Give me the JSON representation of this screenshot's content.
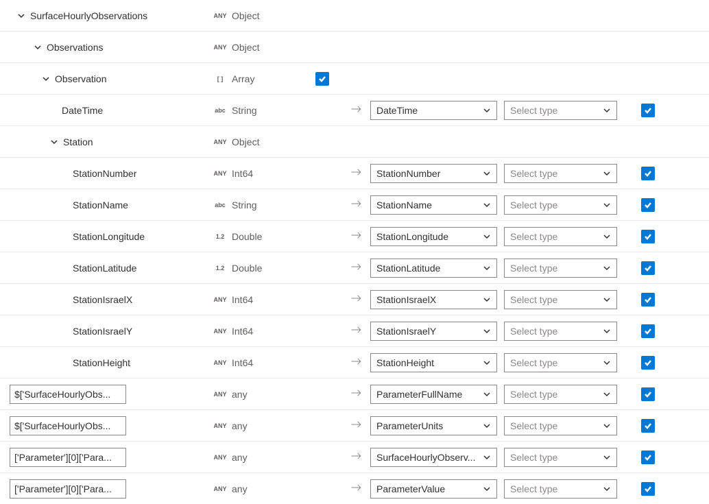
{
  "selectTypePlaceholder": "Select type",
  "rows": [
    {
      "indent": 24,
      "chev": true,
      "name": "SurfaceHourlyObservations",
      "box": false,
      "tIcon": "ANY",
      "tLabel": "Object",
      "leaf": false,
      "rootCheck": false
    },
    {
      "indent": 48,
      "chev": true,
      "name": "Observations",
      "box": false,
      "tIcon": "ANY",
      "tLabel": "Object",
      "leaf": false,
      "rootCheck": false
    },
    {
      "indent": 60,
      "chev": true,
      "name": "Observation",
      "box": false,
      "tIcon": "[ ]",
      "tLabel": "Array",
      "leaf": false,
      "rootCheck": true
    },
    {
      "indent": 90,
      "chev": false,
      "name": "DateTime",
      "box": false,
      "tIcon": "abc",
      "tLabel": "String",
      "leaf": true,
      "map": "DateTime"
    },
    {
      "indent": 72,
      "chev": true,
      "name": "Station",
      "box": false,
      "tIcon": "ANY",
      "tLabel": "Object",
      "leaf": false,
      "rootCheck": false
    },
    {
      "indent": 106,
      "chev": false,
      "name": "StationNumber",
      "box": false,
      "tIcon": "ANY",
      "tLabel": "Int64",
      "leaf": true,
      "map": "StationNumber"
    },
    {
      "indent": 106,
      "chev": false,
      "name": "StationName",
      "box": false,
      "tIcon": "abc",
      "tLabel": "String",
      "leaf": true,
      "map": "StationName"
    },
    {
      "indent": 106,
      "chev": false,
      "name": "StationLongitude",
      "box": false,
      "tIcon": "1.2",
      "tLabel": "Double",
      "leaf": true,
      "map": "StationLongitude"
    },
    {
      "indent": 106,
      "chev": false,
      "name": "StationLatitude",
      "box": false,
      "tIcon": "1.2",
      "tLabel": "Double",
      "leaf": true,
      "map": "StationLatitude"
    },
    {
      "indent": 106,
      "chev": false,
      "name": "StationIsraelX",
      "box": false,
      "tIcon": "ANY",
      "tLabel": "Int64",
      "leaf": true,
      "map": "StationIsraelX"
    },
    {
      "indent": 106,
      "chev": false,
      "name": "StationIsraelY",
      "box": false,
      "tIcon": "ANY",
      "tLabel": "Int64",
      "leaf": true,
      "map": "StationIsraelY"
    },
    {
      "indent": 106,
      "chev": false,
      "name": "StationHeight",
      "box": false,
      "tIcon": "ANY",
      "tLabel": "Int64",
      "leaf": true,
      "map": "StationHeight"
    },
    {
      "indent": 0,
      "chev": false,
      "name": "$['SurfaceHourlyObs...",
      "box": true,
      "tIcon": "ANY",
      "tLabel": "any",
      "leaf": true,
      "map": "ParameterFullName"
    },
    {
      "indent": 0,
      "chev": false,
      "name": "$['SurfaceHourlyObs...",
      "box": true,
      "tIcon": "ANY",
      "tLabel": "any",
      "leaf": true,
      "map": "ParameterUnits"
    },
    {
      "indent": 0,
      "chev": false,
      "name": "['Parameter'][0]['Para...",
      "box": true,
      "tIcon": "ANY",
      "tLabel": "any",
      "leaf": true,
      "map": "SurfaceHourlyObserv..."
    },
    {
      "indent": 0,
      "chev": false,
      "name": "['Parameter'][0]['Para...",
      "box": true,
      "tIcon": "ANY",
      "tLabel": "any",
      "leaf": true,
      "map": "ParameterValue"
    }
  ]
}
